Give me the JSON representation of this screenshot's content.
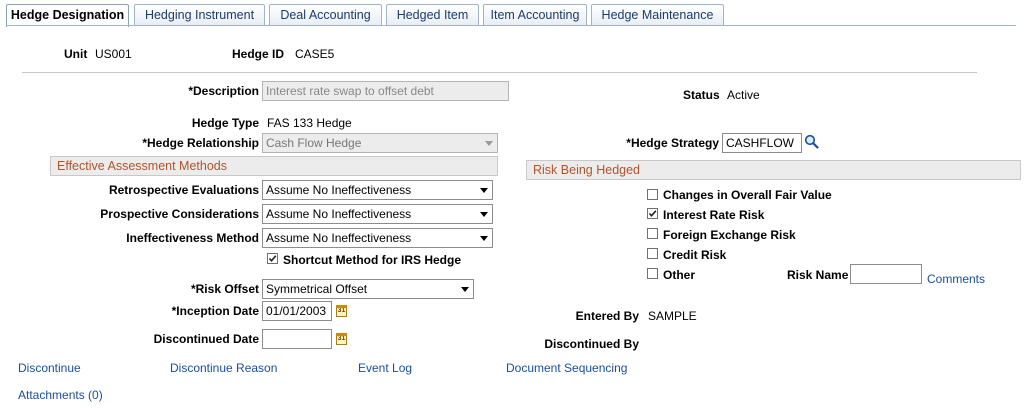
{
  "tabs": [
    {
      "label": "Hedge Designation",
      "active": true
    },
    {
      "label": "Hedging Instrument",
      "active": false
    },
    {
      "label": "Deal Accounting",
      "active": false
    },
    {
      "label": "Hedged Item",
      "active": false
    },
    {
      "label": "Item Accounting",
      "active": false
    },
    {
      "label": "Hedge Maintenance",
      "active": false
    }
  ],
  "header": {
    "unit_label": "Unit",
    "unit_value": "US001",
    "hedge_id_label": "Hedge ID",
    "hedge_id_value": "CASE5"
  },
  "form": {
    "description_label": "*Description",
    "description_value": "Interest rate swap to offset debt",
    "status_label": "Status",
    "status_value": "Active",
    "hedge_type_label": "Hedge Type",
    "hedge_type_value": "FAS 133 Hedge",
    "hedge_relationship_label": "*Hedge Relationship",
    "hedge_relationship_value": "Cash Flow Hedge",
    "hedge_strategy_label": "*Hedge Strategy",
    "hedge_strategy_value": "CASHFLOW"
  },
  "effective": {
    "title": "Effective Assessment Methods",
    "retrospective_label": "Retrospective Evaluations",
    "retrospective_value": "Assume No Ineffectiveness",
    "prospective_label": "Prospective Considerations",
    "prospective_value": "Assume No Ineffectiveness",
    "ineffectiveness_label": "Ineffectiveness Method",
    "ineffectiveness_value": "Assume No Ineffectiveness",
    "shortcut_label": "Shortcut Method for IRS Hedge",
    "shortcut_checked": true
  },
  "risk": {
    "title": "Risk Being Hedged",
    "items": [
      {
        "label": "Changes in Overall Fair Value",
        "checked": false
      },
      {
        "label": "Interest Rate Risk",
        "checked": true
      },
      {
        "label": "Foreign Exchange Risk",
        "checked": false
      },
      {
        "label": "Credit Risk",
        "checked": false
      },
      {
        "label": "Other",
        "checked": false
      }
    ],
    "risk_name_label": "Risk Name",
    "risk_name_value": "",
    "comments_link": "Comments"
  },
  "dates": {
    "risk_offset_label": "*Risk Offset",
    "risk_offset_value": "Symmetrical Offset",
    "inception_label": "*Inception Date",
    "inception_value": "01/01/2003",
    "discontinued_label": "Discontinued Date",
    "discontinued_value": "",
    "entered_by_label": "Entered By",
    "entered_by_value": "SAMPLE",
    "discontinued_by_label": "Discontinued By",
    "discontinued_by_value": ""
  },
  "calendar_glyph": "31",
  "links": {
    "discontinue": "Discontinue",
    "discontinue_reason": "Discontinue Reason",
    "event_log": "Event Log",
    "document_sequencing": "Document Sequencing",
    "attachments": "Attachments (0)"
  },
  "colors": {
    "section_title": "#b3532b",
    "link": "#1a4fa0",
    "tab_text": "#1c3a6e"
  }
}
